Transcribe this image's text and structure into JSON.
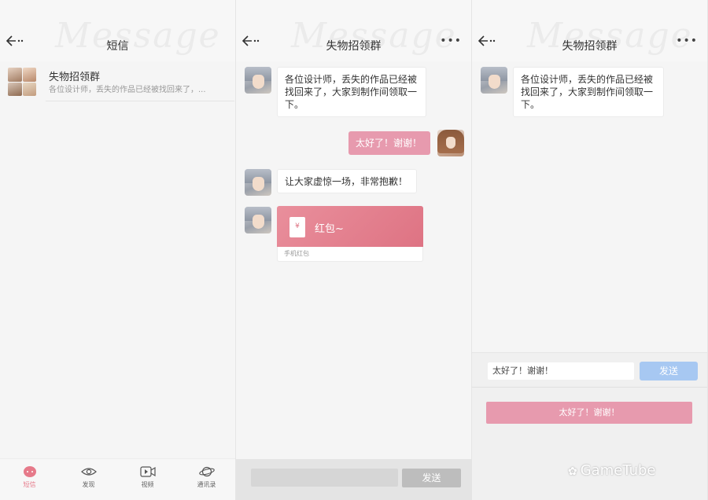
{
  "screen1": {
    "title": "短信",
    "watermark": "Message",
    "conversation": {
      "name": "失物招领群",
      "preview": "各位设计师，丢失的作品已经被找回来了，..."
    },
    "tabs": [
      {
        "label": "短信",
        "icon": "message-icon",
        "active": true
      },
      {
        "label": "发现",
        "icon": "eye-icon",
        "active": false
      },
      {
        "label": "视频",
        "icon": "video-icon",
        "active": false
      },
      {
        "label": "通讯录",
        "icon": "planet-icon",
        "active": false
      }
    ]
  },
  "screen2": {
    "title": "失物招领群",
    "watermark": "Message",
    "messages": [
      {
        "from": "other",
        "text": "各位设计师，丢失的作品已经被找回来了，大家到制作间领取一下。"
      },
      {
        "from": "me",
        "text": "太好了！谢谢！"
      },
      {
        "from": "other",
        "text": "让大家虚惊一场，非常抱歉！"
      }
    ],
    "red_packet": {
      "symbol": "¥",
      "title": "红包~",
      "footer": "手机红包"
    },
    "send_label": "发送"
  },
  "screen3": {
    "title": "失物招领群",
    "watermark": "Message",
    "message": "各位设计师，丢失的作品已经被找回来了，大家到制作间领取一下。",
    "input_value": "太好了！谢谢！",
    "send_label": "发送",
    "reply_option": "太好了！谢谢！"
  },
  "brand": {
    "logo_icon": "wechat-icon",
    "text": "GameTube"
  },
  "colors": {
    "pink": "#e79aae",
    "blue": "#a7c8f2",
    "red_packet": "#de7383"
  }
}
